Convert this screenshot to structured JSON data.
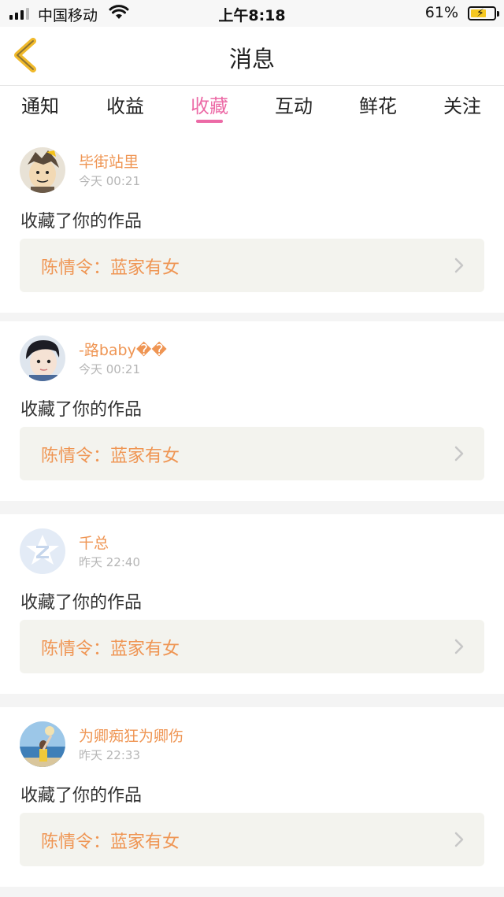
{
  "status_bar": {
    "carrier": "中国移动",
    "time": "上午8:18",
    "battery": "61%"
  },
  "header": {
    "title": "消息"
  },
  "tabs": [
    {
      "label": "通知"
    },
    {
      "label": "收益"
    },
    {
      "label": "收藏",
      "active": true
    },
    {
      "label": "互动"
    },
    {
      "label": "鲜花"
    },
    {
      "label": "关注"
    }
  ],
  "messages": [
    {
      "name": "毕街站里",
      "time": "今天 00:21",
      "action": "收藏了你的作品",
      "work": "陈情令：蓝家有女"
    },
    {
      "name": "-路baby��",
      "time": "今天 00:21",
      "action": "收藏了你的作品",
      "work": "陈情令：蓝家有女"
    },
    {
      "name": "千总",
      "time": "昨天 22:40",
      "action": "收藏了你的作品",
      "work": "陈情令：蓝家有女"
    },
    {
      "name": "为卿痴狂为卿伤",
      "time": "昨天 22:33",
      "action": "收藏了你的作品",
      "work": "陈情令：蓝家有女"
    }
  ],
  "colors": {
    "accent_pink": "#ec6aa6",
    "name_orange": "#ef9553",
    "back_yellow": "#f0b92a"
  },
  "icons": {
    "back": "chevron-left-icon",
    "row_arrow": "chevron-right-icon"
  }
}
